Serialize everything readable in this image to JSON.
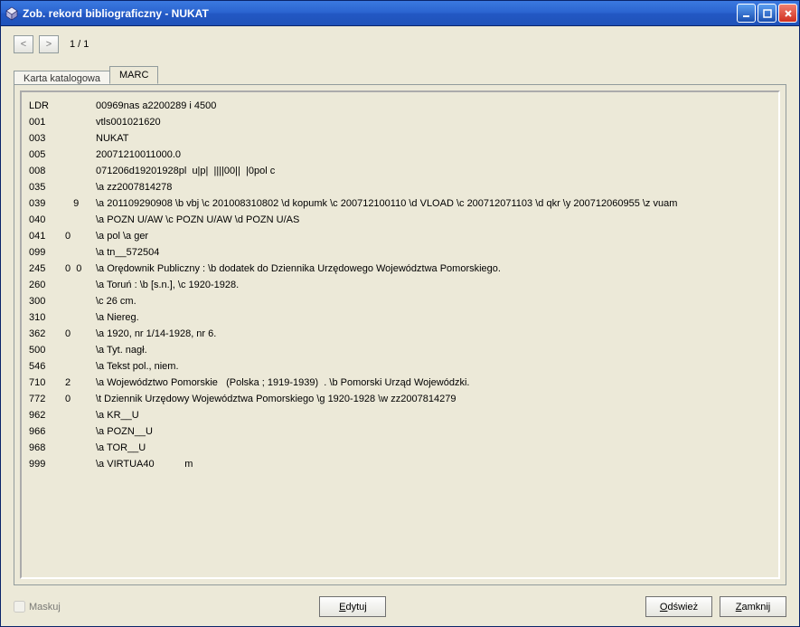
{
  "window": {
    "title": "Zob. rekord bibliograficzny - NUKAT"
  },
  "nav": {
    "prev": "<",
    "next": ">",
    "page_counter": "1 / 1"
  },
  "tabs": {
    "katalog": "Karta katalogowa",
    "marc": "MARC"
  },
  "marc": {
    "fields": [
      {
        "tag": "LDR",
        "ind": "",
        "value": "00969nas a2200289 i 4500"
      },
      {
        "tag": "001",
        "ind": "",
        "value": "vtls001021620"
      },
      {
        "tag": "003",
        "ind": "",
        "value": "NUKAT"
      },
      {
        "tag": "005",
        "ind": "",
        "value": "20071210011000.0"
      },
      {
        "tag": "008",
        "ind": "",
        "value": "071206d19201928pl  u|p|  ||||00||  |0pol c"
      },
      {
        "tag": "035",
        "ind": "",
        "value": "\\a zz2007814278"
      },
      {
        "tag": "039",
        "ind": "   9",
        "value": "\\a 201109290908 \\b vbj \\c 201008310802 \\d kopumk \\c 200712100110 \\d VLOAD \\c 200712071103 \\d qkr \\y 200712060955 \\z vuam"
      },
      {
        "tag": "040",
        "ind": "",
        "value": "\\a POZN U/AW \\c POZN U/AW \\d POZN U/AS"
      },
      {
        "tag": "041",
        "ind": "0",
        "value": "\\a pol \\a ger"
      },
      {
        "tag": "099",
        "ind": "",
        "value": "\\a tn__572504"
      },
      {
        "tag": "245",
        "ind": "0  0",
        "value": "\\a Orędownik Publiczny : \\b dodatek do Dziennika Urzędowego Województwa Pomorskiego."
      },
      {
        "tag": "260",
        "ind": "",
        "value": "\\a Toruń : \\b [s.n.], \\c 1920-1928."
      },
      {
        "tag": "300",
        "ind": "",
        "value": "\\c 26 cm."
      },
      {
        "tag": "310",
        "ind": "",
        "value": "\\a Niereg."
      },
      {
        "tag": "362",
        "ind": "0",
        "value": "\\a 1920, nr 1/14-1928, nr 6."
      },
      {
        "tag": "500",
        "ind": "",
        "value": "\\a Tyt. nagł."
      },
      {
        "tag": "546",
        "ind": "",
        "value": "\\a Tekst pol., niem."
      },
      {
        "tag": "710",
        "ind": "2",
        "value": "\\a Województwo Pomorskie   (Polska ; 1919-1939)  . \\b Pomorski Urząd Wojewódzki."
      },
      {
        "tag": "772",
        "ind": "0",
        "value": "\\t Dziennik Urzędowy Województwa Pomorskiego \\g 1920-1928 \\w zz2007814279"
      },
      {
        "tag": "962",
        "ind": "",
        "value": "\\a KR__U"
      },
      {
        "tag": "966",
        "ind": "",
        "value": "\\a POZN__U"
      },
      {
        "tag": "968",
        "ind": "",
        "value": "\\a TOR__U"
      },
      {
        "tag": "999",
        "ind": "",
        "value": "\\a VIRTUA40           m"
      }
    ]
  },
  "bottom": {
    "mask_label": "Maskuj",
    "edit_label": "Edytuj",
    "refresh_label": "Odśwież",
    "close_label": "Zamknij"
  }
}
